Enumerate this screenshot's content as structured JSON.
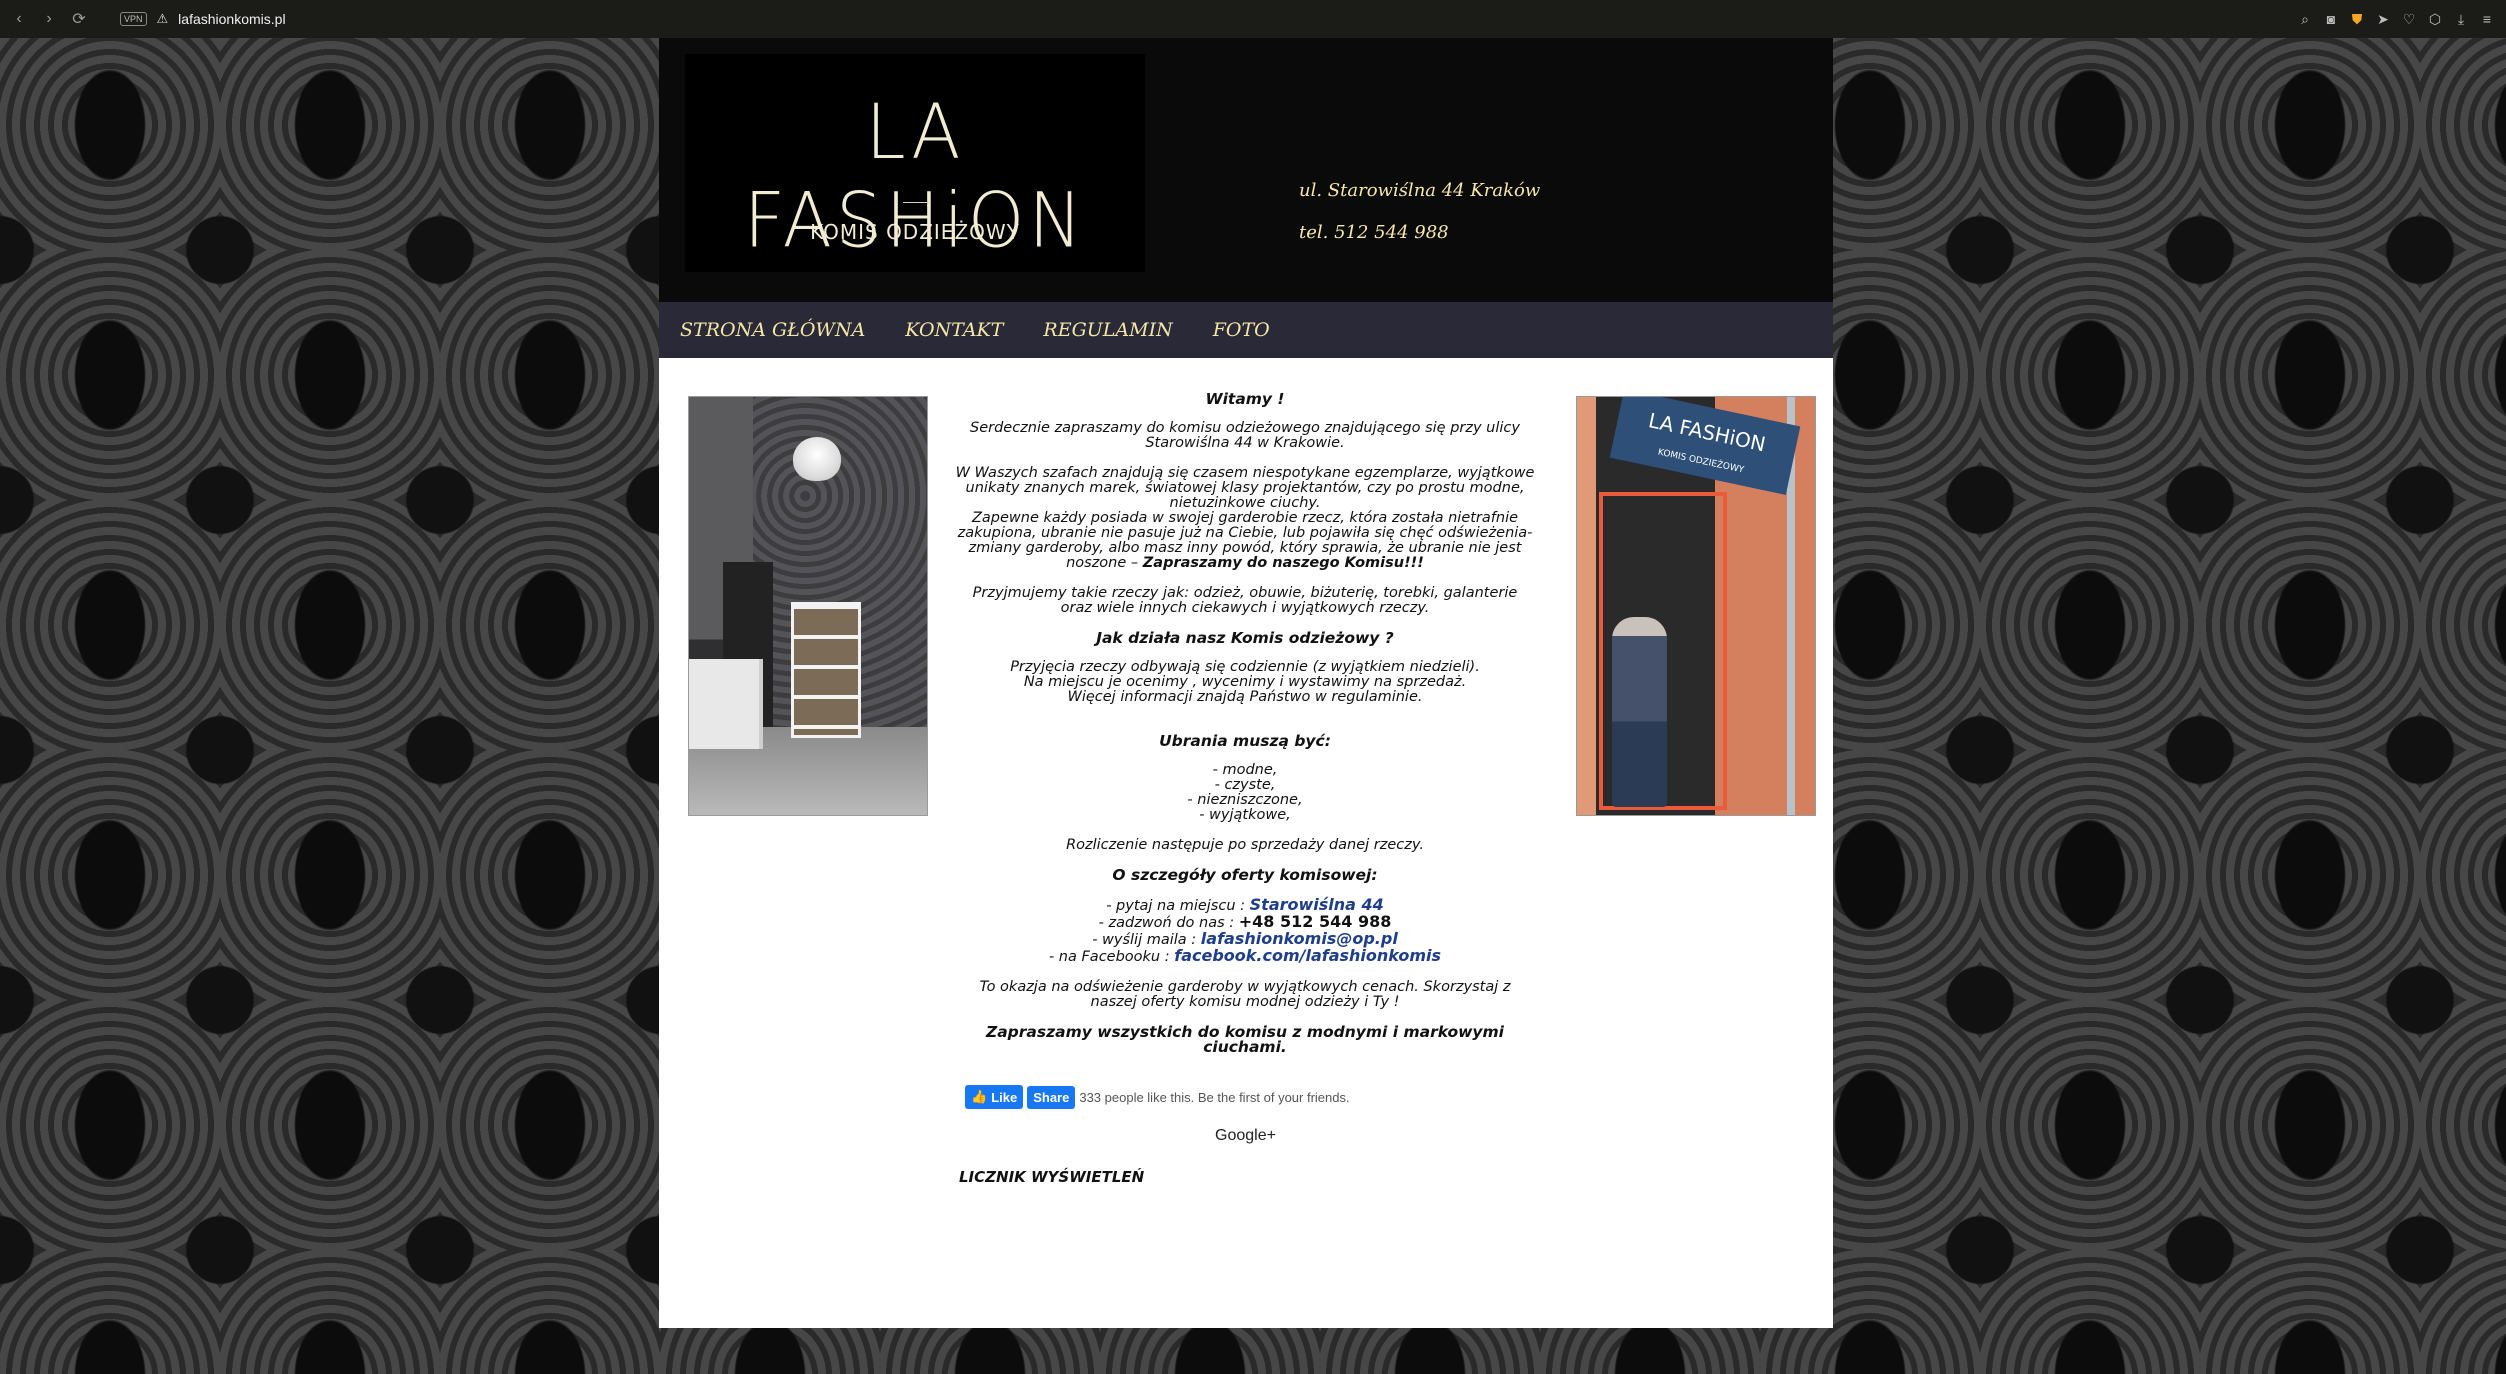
{
  "browser": {
    "vpn_label": "VPN",
    "url": "lafashionkomis.pl",
    "icons": [
      "back-icon",
      "forward-icon",
      "reload-icon",
      "warning-icon",
      "search-icon",
      "camera-icon",
      "shield-icon",
      "send-icon",
      "heart-icon",
      "box-icon",
      "download-icon",
      "menu-icon"
    ]
  },
  "header": {
    "logo_title": "LA FASHiON",
    "logo_subtitle": "KOMIS ODZIEŻOWY",
    "address": "ul. Starowiślna 44 Kraków",
    "phone": "tel. 512 544 988"
  },
  "nav": {
    "items": [
      {
        "label": "STRONA GŁÓWNA"
      },
      {
        "label": "KONTAKT"
      },
      {
        "label": "REGULAMIN"
      },
      {
        "label": "FOTO"
      }
    ]
  },
  "content": {
    "greeting": "Witamy !",
    "intro": "Serdecznie zapraszamy do komisu odzieżowego znajdującego się przy ulicy Starowiślna 44 w Krakowie.",
    "p1": "W Waszych szafach znajdują się czasem niespotykane egzemplarze, wyjątkowe unikaty znanych marek, światowej klasy projektantów, czy po prostu modne, nietuzinkowe ciuchy.",
    "p2": "Zapewne każdy posiada w swojej garderobie rzecz, która została nietrafnie zakupiona, ubranie nie pasuje już na Ciebie, lub pojawiła się chęć odświeżenia-zmiany garderoby, albo masz inny powód, który sprawia, że ubranie nie jest noszone –",
    "p2_bold": "Zapraszamy do naszego Komisu!!!",
    "p3": "Przyjmujemy takie rzeczy jak: odzież, obuwie, biżuterię, torebki, galanterie oraz wiele innych ciekawych i wyjątkowych rzeczy.",
    "how_heading": "Jak działa nasz Komis odzieżowy ?",
    "how1": "Przyjęcia rzeczy odbywają się codziennie (z wyjątkiem niedzieli).",
    "how2": "Na miejscu je ocenimy , wycenimy i wystawimy na sprzedaż.",
    "how3": "Więcej informacji znajdą Państwo w regulaminie.",
    "must_heading": "Ubrania muszą być:",
    "must_items": [
      "- modne,",
      "- czyste,",
      "- niezniszczone,",
      "- wyjątkowe,"
    ],
    "settlement": "Rozliczenie następuje po sprzedaży danej rzeczy.",
    "details_heading": "O szczegóły oferty komisowej:",
    "contact_ask": "- pytaj na miejscu :",
    "contact_ask_value": "Starowiślna 44",
    "contact_call": "- zadzwoń do nas :",
    "contact_call_value": "+48  512 544 988",
    "contact_mail": "- wyślij maila :",
    "contact_mail_value": "lafashionkomis@op.pl",
    "contact_fb": "- na Facebooku :",
    "contact_fb_value": "facebook.com/lafashionkomis",
    "occasion": "To okazja na odświeżenie garderoby w wyjątkowych cenach. Skorzystaj z naszej oferty komisu modnej odzieży i Ty !",
    "invite": "Zapraszamy wszystkich do komisu z modnymi i markowymi ciuchami."
  },
  "social": {
    "like_label": "Like",
    "share_label": "Share",
    "count_text": "333 people like this. Be the first of your friends.",
    "google_label": "Google+"
  },
  "footer": {
    "counter_label": "LICZNIK WYŚWIETLEŃ"
  }
}
